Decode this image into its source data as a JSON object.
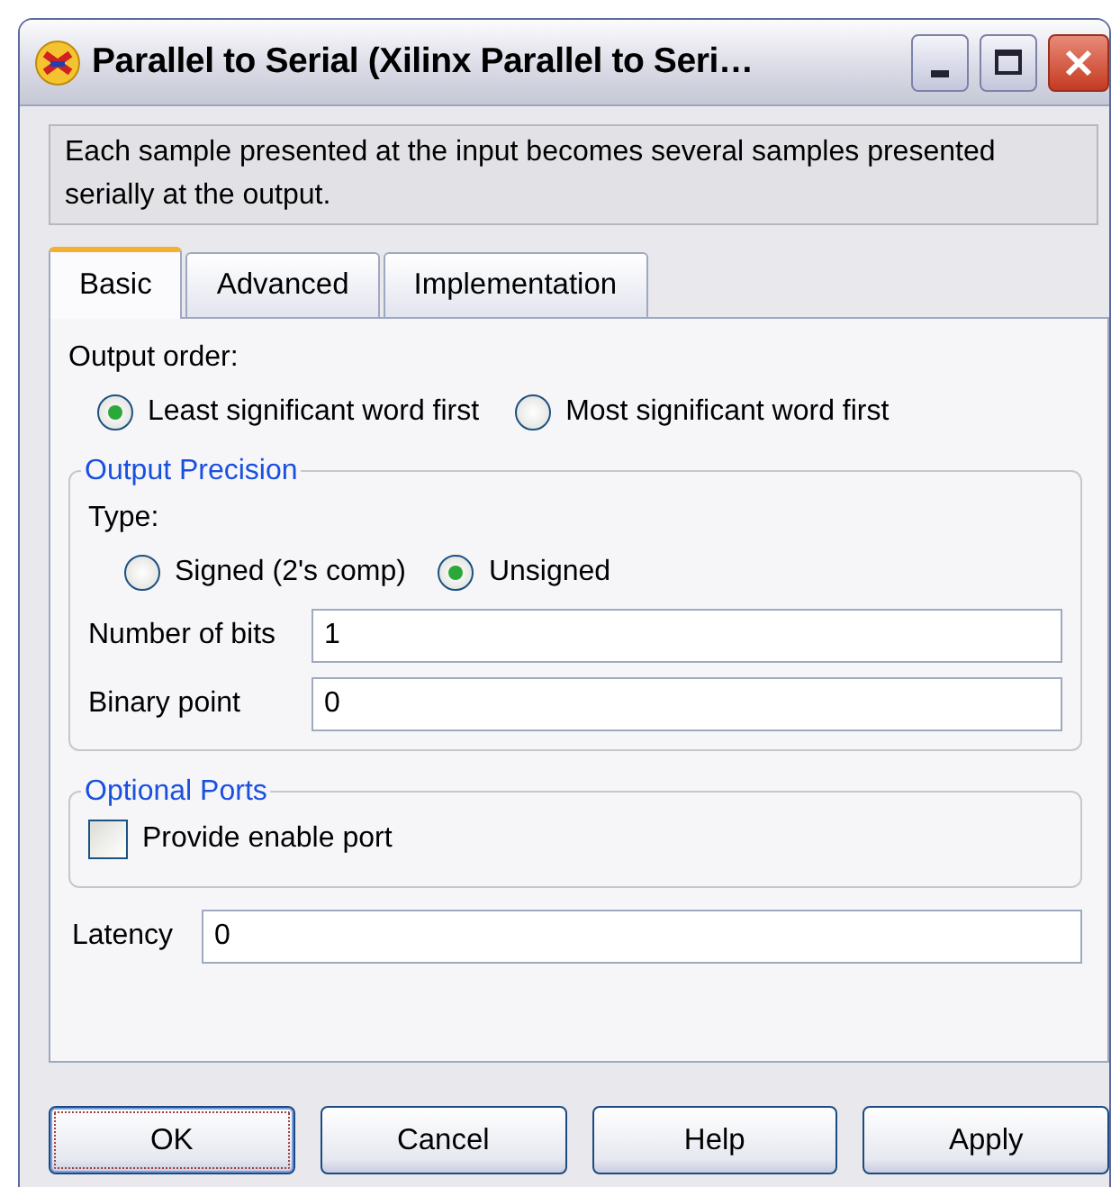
{
  "window": {
    "title": "Parallel to Serial (Xilinx Parallel to Seri…"
  },
  "description": "Each sample presented at the input becomes several samples presented serially at the output.",
  "tabs": [
    {
      "label": "Basic",
      "selected": true
    },
    {
      "label": "Advanced",
      "selected": false
    },
    {
      "label": "Implementation",
      "selected": false
    }
  ],
  "output_order": {
    "label": "Output order:",
    "options": [
      {
        "label": "Least significant word first",
        "selected": true
      },
      {
        "label": "Most significant word first",
        "selected": false
      }
    ]
  },
  "output_precision": {
    "legend": "Output Precision",
    "type_label": "Type:",
    "options": [
      {
        "label": "Signed (2's comp)",
        "selected": false
      },
      {
        "label": "Unsigned",
        "selected": true
      }
    ],
    "fields": [
      {
        "label": "Number of bits",
        "value": "1"
      },
      {
        "label": "Binary point",
        "value": "0"
      }
    ]
  },
  "optional_ports": {
    "legend": "Optional Ports",
    "checkboxes": [
      {
        "label": "Provide enable port",
        "checked": false
      }
    ]
  },
  "latency": {
    "label": "Latency",
    "value": "0"
  },
  "buttons": [
    {
      "label": "OK",
      "default": true
    },
    {
      "label": "Cancel",
      "default": false
    },
    {
      "label": "Help",
      "default": false
    },
    {
      "label": "Apply",
      "default": false
    }
  ]
}
